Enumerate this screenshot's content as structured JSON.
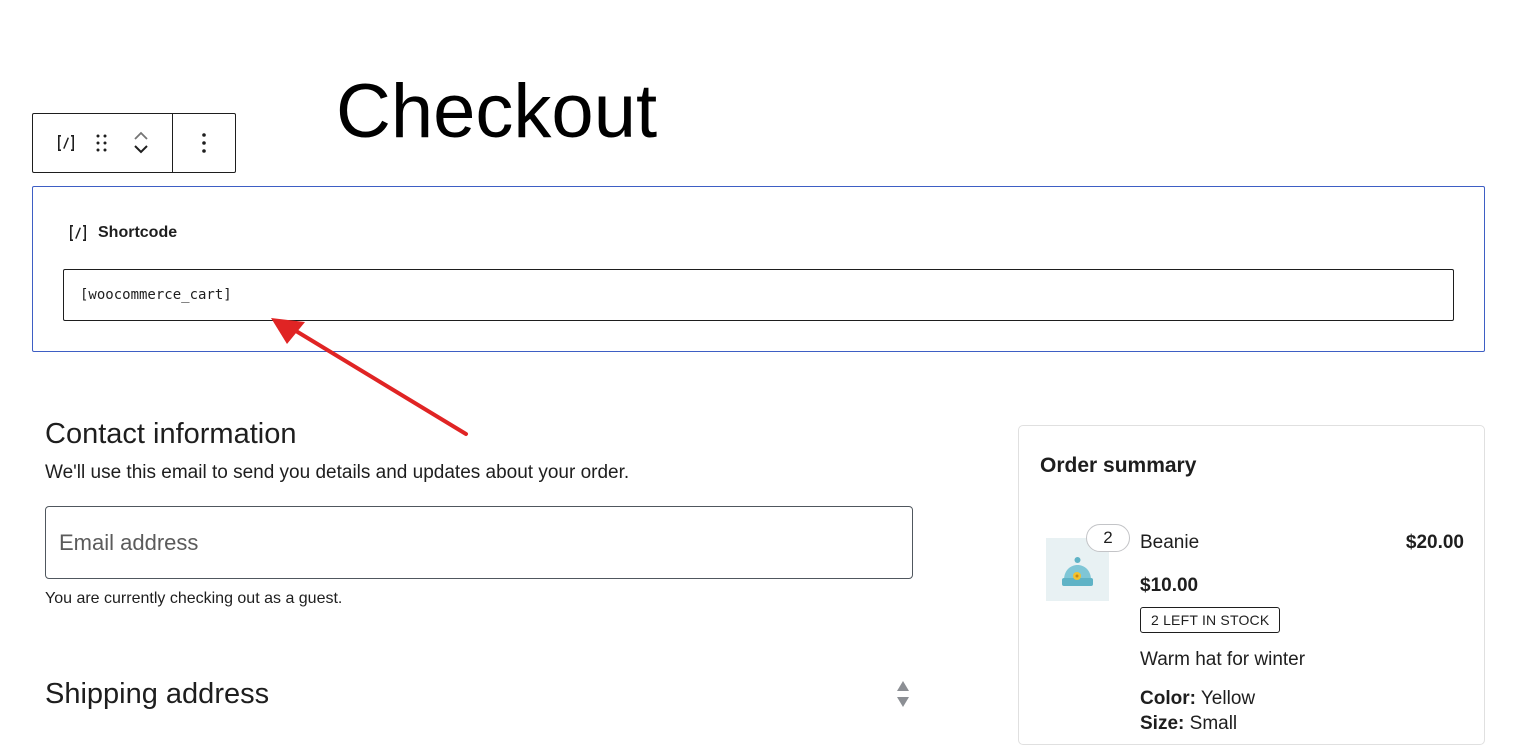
{
  "page_title": "Checkout",
  "shortcode_block": {
    "label": "Shortcode",
    "value": "[woocommerce_cart]"
  },
  "contact": {
    "heading": "Contact information",
    "description": "We'll use this email to send you details and updates about your order.",
    "email_placeholder": "Email address",
    "guest_note": "You are currently checking out as a guest."
  },
  "shipping": {
    "heading": "Shipping address"
  },
  "order_summary": {
    "title": "Order summary",
    "item": {
      "quantity": "2",
      "name": "Beanie",
      "line_total": "$20.00",
      "unit_price": "$10.00",
      "stock_badge": "2 LEFT IN STOCK",
      "description": "Warm hat for winter",
      "color_label": "Color:",
      "color_value": "Yellow",
      "size_label": "Size:",
      "size_value": "Small"
    }
  },
  "colors": {
    "block_outline": "#3e5ec4",
    "annotation_arrow": "#e02424"
  },
  "icons": {
    "block_type": "shortcode-icon",
    "drag": "drag-handle-icon",
    "move": "move-up-down-icon",
    "options": "more-vertical-icon"
  }
}
